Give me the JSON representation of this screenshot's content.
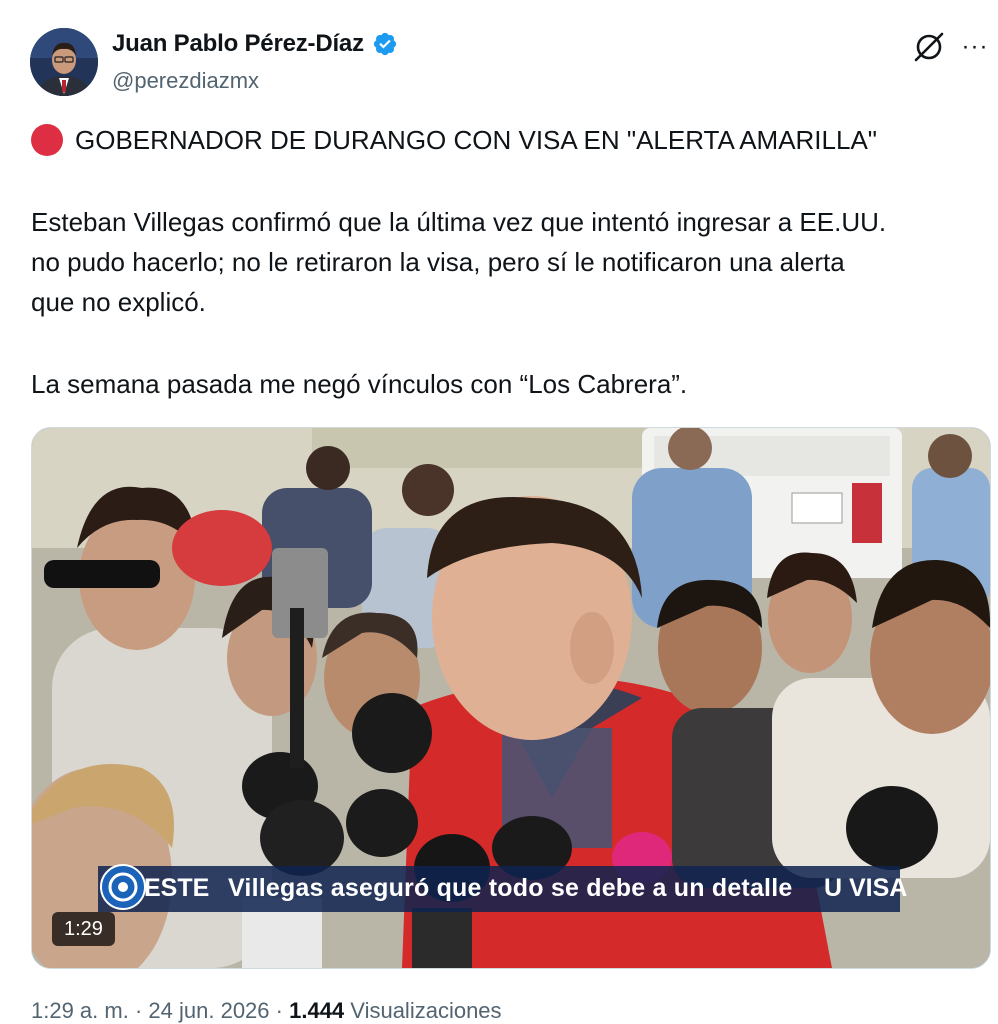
{
  "author": {
    "display_name": "Juan Pablo Pérez-Díaz",
    "handle": "@perezdiazmx",
    "verified": true,
    "verified_color": "#1d9bf0"
  },
  "header_icons": [
    "grok-icon",
    "more-icon"
  ],
  "more_label": "···",
  "tweet": {
    "headline_icon": "red-circle-icon",
    "headline": "GOBERNADOR DE DURANGO CON VISA EN \"ALERTA AMARILLA\"",
    "paragraph1_line1": "Esteban Villegas confirmó que la última vez que intentó ingresar a EE.UU.",
    "paragraph1_line2": "no pudo hacerlo; no le retiraron la visa, pero sí le notificaron una alerta",
    "paragraph1_line3": "que no explicó.",
    "paragraph2": "La semana pasada me negó vínculos con “Los Cabrera”."
  },
  "video": {
    "caption_left": "ESTE",
    "caption": "Villegas aseguró que todo se debe a un detalle",
    "caption_right": "U VISA",
    "duration": "1:29",
    "caption_color": "#0f2350"
  },
  "meta": {
    "time": "1:29 a. m.",
    "date": "24 jun. 2026",
    "separator": "·",
    "views_count": "1.444",
    "views_label": "Visualizaciones"
  }
}
